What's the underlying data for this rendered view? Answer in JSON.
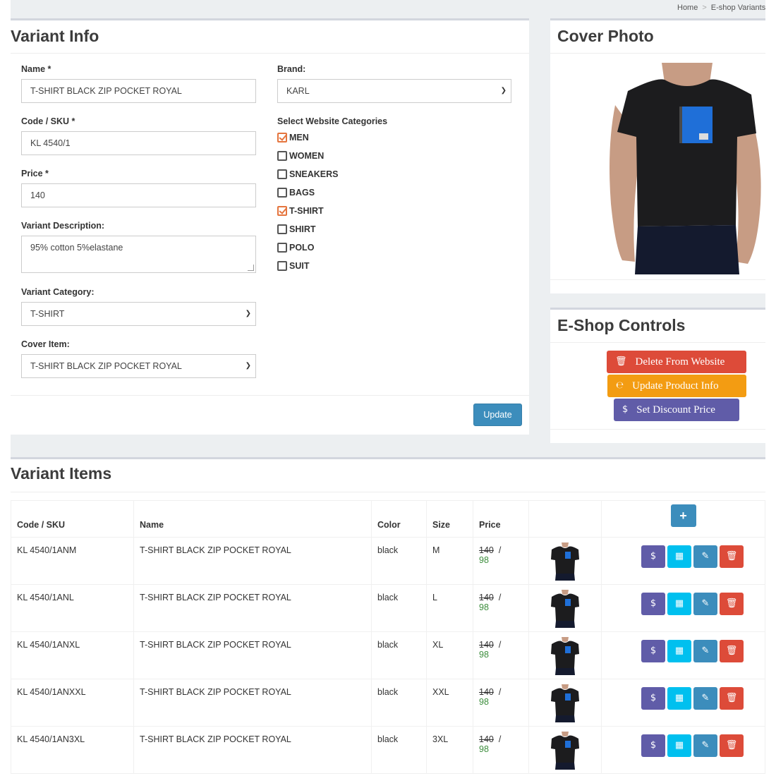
{
  "breadcrumb": {
    "home": "Home",
    "current": "E-shop Variants"
  },
  "variant_info": {
    "title": "Variant Info",
    "name_label": "Name *",
    "name_value": "T-SHIRT BLACK ZIP POCKET ROYAL",
    "brand_label": "Brand:",
    "brand_value": "KARL",
    "code_label": "Code / SKU *",
    "code_value": "KL 4540/1",
    "price_label": "Price *",
    "price_value": "140",
    "description_label": "Variant Description:",
    "description_value": "95% cotton 5%elastane",
    "category_label": "Variant Category:",
    "category_value": "T-SHIRT",
    "cover_item_label": "Cover Item:",
    "cover_item_value": "T-SHIRT BLACK ZIP POCKET ROYAL",
    "website_categories_label": "Select Website Categories",
    "website_categories": [
      {
        "label": "MEN",
        "checked": true
      },
      {
        "label": "WOMEN",
        "checked": false
      },
      {
        "label": "SNEAKERS",
        "checked": false
      },
      {
        "label": "BAGS",
        "checked": false
      },
      {
        "label": "T-SHIRT",
        "checked": true
      },
      {
        "label": "SHIRT",
        "checked": false
      },
      {
        "label": "POLO",
        "checked": false
      },
      {
        "label": "SUIT",
        "checked": false
      }
    ],
    "update_label": "Update"
  },
  "cover_photo": {
    "title": "Cover Photo"
  },
  "eshop_controls": {
    "title": "E-Shop Controls",
    "delete_label": "Delete From Website",
    "update_label": "Update Product Info",
    "discount_label": "Set Discount Price",
    "colors": {
      "delete": "#dd4b39",
      "update": "#f39c12",
      "discount": "#605ca8"
    }
  },
  "variant_items": {
    "title": "Variant Items",
    "columns": [
      "Code / SKU",
      "Name",
      "Color",
      "Size",
      "Price"
    ],
    "rows": [
      {
        "sku": "KL 4540/1ANM",
        "name": "T-SHIRT BLACK ZIP POCKET ROYAL",
        "color": "black",
        "size": "M",
        "price_old": "140",
        "price_sep": "/",
        "price_new": "98"
      },
      {
        "sku": "KL 4540/1ANL",
        "name": "T-SHIRT BLACK ZIP POCKET ROYAL",
        "color": "black",
        "size": "L",
        "price_old": "140",
        "price_sep": "/",
        "price_new": "98"
      },
      {
        "sku": "KL 4540/1ANXL",
        "name": "T-SHIRT BLACK ZIP POCKET ROYAL",
        "color": "black",
        "size": "XL",
        "price_old": "140",
        "price_sep": "/",
        "price_new": "98"
      },
      {
        "sku": "KL 4540/1ANXXL",
        "name": "T-SHIRT BLACK ZIP POCKET ROYAL",
        "color": "black",
        "size": "XXL",
        "price_old": "140",
        "price_sep": "/",
        "price_new": "98"
      },
      {
        "sku": "KL 4540/1AN3XL",
        "name": "T-SHIRT BLACK ZIP POCKET ROYAL",
        "color": "black",
        "size": "3XL",
        "price_old": "140",
        "price_sep": "/",
        "price_new": "98"
      }
    ],
    "action_colors": {
      "discount": "#605ca8",
      "images": "#00c0ef",
      "edit": "#3c8dbc",
      "delete": "#dd4b39"
    }
  }
}
